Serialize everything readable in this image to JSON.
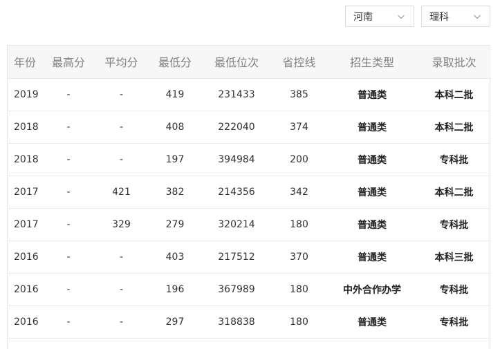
{
  "filters": {
    "province": {
      "value": "河南",
      "icon": "chevron-down-icon"
    },
    "subject": {
      "value": "理科",
      "icon": "chevron-down-icon"
    }
  },
  "table": {
    "headers": [
      "年份",
      "最高分",
      "平均分",
      "最低分",
      "最低位次",
      "省控线",
      "招生类型",
      "录取批次"
    ],
    "rows": [
      [
        "2019",
        "-",
        "-",
        "419",
        "231433",
        "385",
        "普通类",
        "本科二批"
      ],
      [
        "2018",
        "-",
        "-",
        "408",
        "222040",
        "374",
        "普通类",
        "本科二批"
      ],
      [
        "2018",
        "-",
        "-",
        "197",
        "394984",
        "200",
        "普通类",
        "专科批"
      ],
      [
        "2017",
        "-",
        "421",
        "382",
        "214356",
        "342",
        "普通类",
        "本科二批"
      ],
      [
        "2017",
        "-",
        "329",
        "279",
        "320214",
        "180",
        "普通类",
        "专科批"
      ],
      [
        "2016",
        "-",
        "-",
        "403",
        "217512",
        "370",
        "普通类",
        "本科三批"
      ],
      [
        "2016",
        "-",
        "-",
        "196",
        "367989",
        "180",
        "中外合作办学",
        "专科批"
      ],
      [
        "2016",
        "-",
        "-",
        "297",
        "318838",
        "180",
        "普通类",
        "专科批"
      ]
    ]
  }
}
